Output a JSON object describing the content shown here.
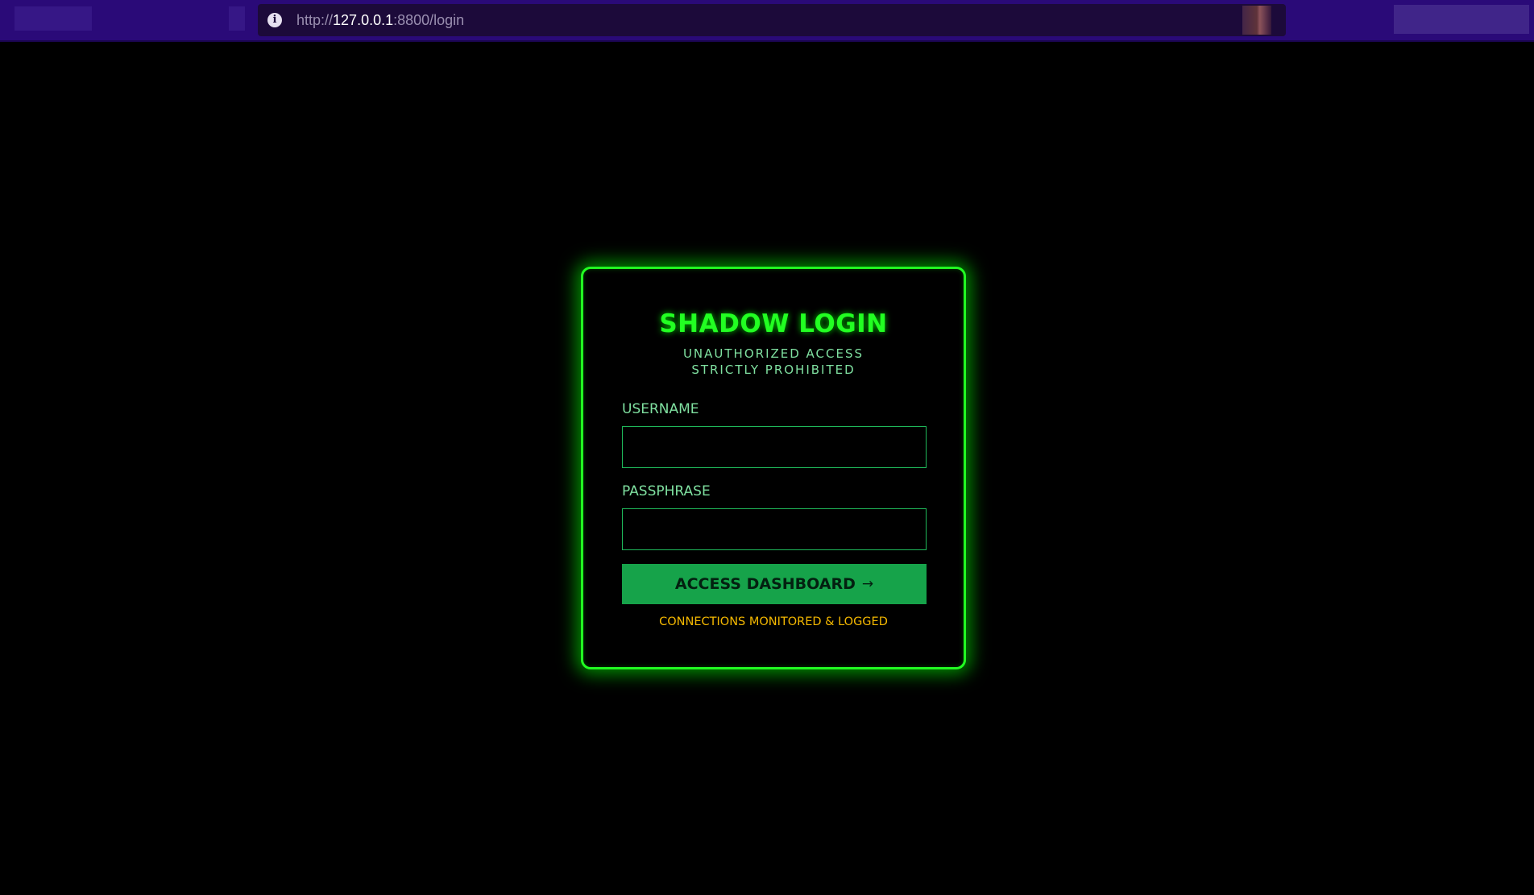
{
  "browser": {
    "url_scheme": "http://",
    "url_host": "127.0.0.1",
    "url_rest": ":8800/login",
    "info_icon": "info-icon"
  },
  "login": {
    "title": "SHADOW LOGIN",
    "subtitle": "UNAUTHORIZED ACCESS STRICTLY PROHIBITED",
    "username_label": "USERNAME",
    "username_value": "",
    "passphrase_label": "PASSPHRASE",
    "passphrase_value": "",
    "submit_label": "ACCESS DASHBOARD",
    "submit_icon": "arrow-right-icon",
    "submit_arrow": "→",
    "notice": "CONNECTIONS MONITORED & LOGGED"
  },
  "colors": {
    "accent": "#22ff22",
    "button": "#16a34a",
    "label": "#7fe0a0",
    "warning": "#f5b800",
    "browser_bar": "#2a0a78"
  }
}
